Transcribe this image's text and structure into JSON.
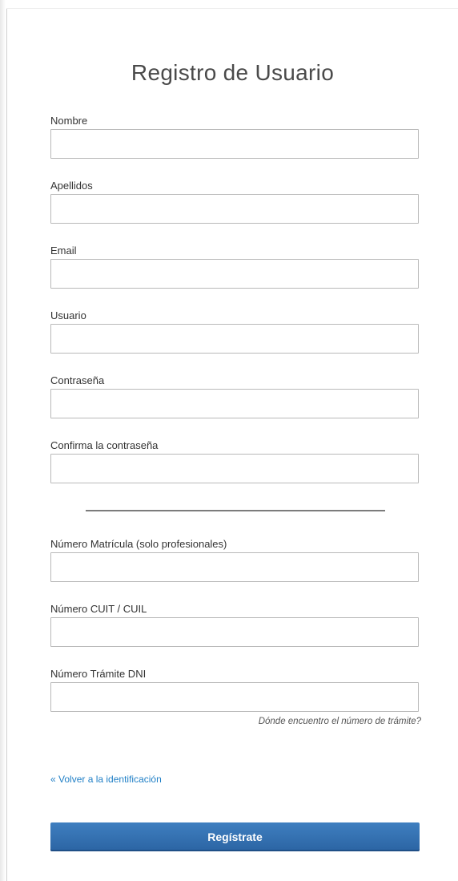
{
  "form": {
    "title": "Registro de Usuario",
    "fields": [
      {
        "label": "Nombre",
        "value": "",
        "placeholder": ""
      },
      {
        "label": "Apellidos",
        "value": "",
        "placeholder": ""
      },
      {
        "label": "Email",
        "value": "",
        "placeholder": ""
      },
      {
        "label": "Usuario",
        "value": "",
        "placeholder": ""
      },
      {
        "label": "Contraseña",
        "value": "",
        "placeholder": ""
      },
      {
        "label": "Confirma la contraseña",
        "value": "",
        "placeholder": ""
      },
      {
        "label": "Número Matrícula (solo profesionales)",
        "value": "",
        "placeholder": ""
      },
      {
        "label": "Número CUIT / CUIL",
        "value": "",
        "placeholder": ""
      },
      {
        "label": "Número Trámite DNI",
        "value": "",
        "placeholder": ""
      }
    ],
    "help_link": "Dónde encuentro el número de trámite?",
    "back_link": "« Volver a la identificación",
    "submit_label": "Regístrate"
  },
  "colors": {
    "accent": "#2f6eb0",
    "link": "#1f7fc6",
    "input_border": "#b9b9b9"
  }
}
